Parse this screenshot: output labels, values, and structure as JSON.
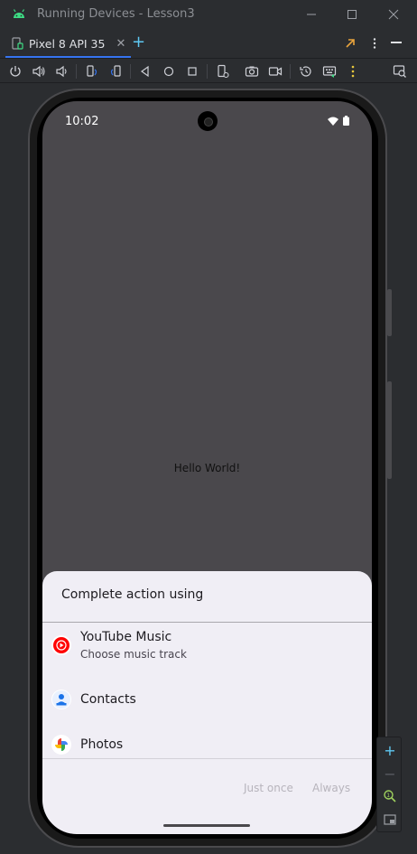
{
  "window": {
    "title": "Running Devices - Lesson3"
  },
  "tabs": [
    {
      "label": "Pixel 8 API 35"
    }
  ],
  "device": {
    "status_time": "10:02",
    "hello_text": "Hello World!"
  },
  "chooser": {
    "title": "Complete action using",
    "items": [
      {
        "name": "YouTube Music",
        "subtitle": "Choose music track",
        "icon": "youtube-music-icon"
      },
      {
        "name": "Contacts",
        "subtitle": "",
        "icon": "contacts-icon"
      },
      {
        "name": "Photos",
        "subtitle": "",
        "icon": "photos-icon"
      }
    ],
    "just_once": "Just once",
    "always": "Always"
  },
  "colors": {
    "accent": "#3574f0",
    "add_tab": "#5ec8f2",
    "android_green": "#3ddc84",
    "screen_bg": "#4a484c",
    "sheet_bg": "#f0eef5"
  }
}
